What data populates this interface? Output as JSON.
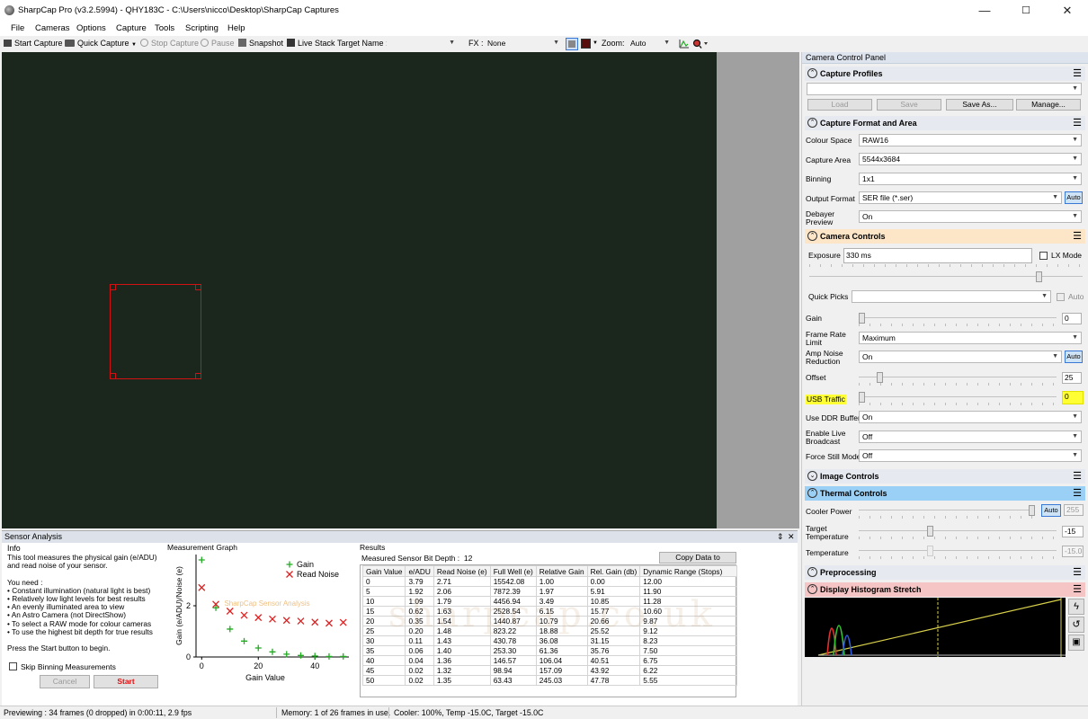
{
  "window": {
    "title": "SharpCap Pro (v3.2.5994) - QHY183C - C:\\Users\\nicco\\Desktop\\SharpCap Captures",
    "controls": {
      "minimize": "—",
      "maximize": "☐",
      "close": "✕"
    }
  },
  "menu": [
    "File",
    "Cameras",
    "Options",
    "Capture",
    "Tools",
    "Scripting",
    "Help"
  ],
  "toolbar": {
    "start_capture": "Start Capture",
    "quick_capture": "Quick Capture",
    "stop_capture": "Stop Capture",
    "pause": "Pause",
    "snapshot": "Snapshot",
    "live_stack": "Live Stack",
    "target_label": "Target Name :",
    "target_value": "",
    "fx_label": "FX :",
    "fx_value": "None",
    "zoom_label": "Zoom:",
    "zoom_value": "Auto"
  },
  "sensor_analysis": {
    "title": "Sensor Analysis",
    "pin": "⇕",
    "close": "✕",
    "info_title": "Info",
    "info_lines": [
      "This tool measures the physical gain (e/ADU)",
      "and read noise of your sensor.",
      "",
      "You need :",
      "• Constant illumination (natural light is best)",
      "• Relatively low light levels for best results",
      "• An evenly illuminated area to view",
      "• An Astro Camera (not DirectShow)",
      "• To select a RAW mode for colour cameras",
      "• To use the highest bit depth for true results",
      "",
      "Press the Start button to begin."
    ],
    "skip_binning": "Skip Binning Measurements",
    "cancel": "Cancel",
    "start": "Start",
    "graph_title": "Measurement Graph",
    "results_title": "Results",
    "bit_depth_label": "Measured Sensor Bit Depth :",
    "bit_depth_value": "12",
    "copy_button": "Copy Data to Clipboard",
    "table_headers": [
      "Gain Value",
      "e/ADU",
      "Read Noise (e)",
      "Full Well (e)",
      "Relative Gain",
      "Rel. Gain (db)",
      "Dynamic Range (Stops)"
    ],
    "table_rows": [
      [
        "0",
        "3.79",
        "2.71",
        "15542.08",
        "1.00",
        "0.00",
        "12.00"
      ],
      [
        "5",
        "1.92",
        "2.06",
        "7872.39",
        "1.97",
        "5.91",
        "11.90"
      ],
      [
        "10",
        "1.09",
        "1.79",
        "4456.94",
        "3.49",
        "10.85",
        "11.28"
      ],
      [
        "15",
        "0.62",
        "1.63",
        "2528.54",
        "6.15",
        "15.77",
        "10.60"
      ],
      [
        "20",
        "0.35",
        "1.54",
        "1440.87",
        "10.79",
        "20.66",
        "9.87"
      ],
      [
        "25",
        "0.20",
        "1.48",
        "823.22",
        "18.88",
        "25.52",
        "9.12"
      ],
      [
        "30",
        "0.11",
        "1.43",
        "430.78",
        "36.08",
        "31.15",
        "8.23"
      ],
      [
        "35",
        "0.06",
        "1.40",
        "253.30",
        "61.36",
        "35.76",
        "7.50"
      ],
      [
        "40",
        "0.04",
        "1.36",
        "146.57",
        "106.04",
        "40.51",
        "6.75"
      ],
      [
        "45",
        "0.02",
        "1.32",
        "98.94",
        "157.09",
        "43.92",
        "6.22"
      ],
      [
        "50",
        "0.02",
        "1.35",
        "63.43",
        "245.03",
        "47.78",
        "5.55"
      ]
    ],
    "graph_watermark": "SharpCap Sensor Analysis",
    "watermark": "sharpcap.co.uk"
  },
  "chart_data": {
    "type": "scatter",
    "xlabel": "Gain Value",
    "ylabel": "Gain (e/ADU)/Noise (e)",
    "xlim": [
      -2,
      52
    ],
    "ylim": [
      0,
      4
    ],
    "xticks": [
      "0",
      "20",
      "40"
    ],
    "yticks": [
      "0",
      "2"
    ],
    "series": [
      {
        "name": "Gain",
        "marker": "+",
        "color": "#22aa22",
        "x": [
          0,
          5,
          10,
          15,
          20,
          25,
          30,
          35,
          40,
          45,
          50
        ],
        "y": [
          3.79,
          1.92,
          1.09,
          0.62,
          0.35,
          0.2,
          0.11,
          0.06,
          0.04,
          0.02,
          0.02
        ]
      },
      {
        "name": "Read Noise",
        "marker": "x",
        "color": "#dd2222",
        "x": [
          0,
          5,
          10,
          15,
          20,
          25,
          30,
          35,
          40,
          45,
          50
        ],
        "y": [
          2.71,
          2.06,
          1.79,
          1.63,
          1.54,
          1.48,
          1.43,
          1.4,
          1.36,
          1.32,
          1.35
        ]
      }
    ],
    "legend": "top-right"
  },
  "status": {
    "preview": "Previewing : 34 frames (0 dropped) in 0:00:11, 2.9 fps",
    "memory": "Memory: 1 of 26 frames in use.",
    "cooler": "Cooler: 100%, Temp -15.0C, Target -15.0C"
  },
  "panel": {
    "title": "Camera Control Panel",
    "capture_profiles": {
      "title": "Capture Profiles",
      "load": "Load",
      "save": "Save",
      "save_as": "Save As...",
      "manage": "Manage...",
      "profile_value": ""
    },
    "capture_format": {
      "title": "Capture Format and Area",
      "colour_space_label": "Colour Space",
      "colour_space": "RAW16",
      "capture_area_label": "Capture Area",
      "capture_area": "5544x3684",
      "binning_label": "Binning",
      "binning": "1x1",
      "output_format_label": "Output Format",
      "output_format": "SER file (*.ser)",
      "auto": "Auto",
      "debayer_label_1": "Debayer",
      "debayer_label_2": "Preview",
      "debayer": "On"
    },
    "camera_controls": {
      "title": "Camera Controls",
      "exposure_label": "Exposure",
      "exposure": "330 ms",
      "lx_mode": "LX Mode",
      "quick_picks_label": "Quick Picks",
      "quick_picks_auto": "Auto",
      "gain_label": "Gain",
      "gain": "0",
      "frame_rate_label_1": "Frame Rate",
      "frame_rate_label_2": "Limit",
      "frame_rate": "Maximum",
      "amp_noise_label_1": "Amp Noise",
      "amp_noise_label_2": "Reduction",
      "amp_noise": "On",
      "amp_auto": "Auto",
      "offset_label": "Offset",
      "offset": "25",
      "usb_label": "USB Traffic",
      "usb": "0",
      "ddr_label": "Use DDR Buffer",
      "ddr": "On",
      "broadcast_label_1": "Enable Live",
      "broadcast_label_2": "Broadcast",
      "broadcast": "Off",
      "force_still_label": "Force Still Mode",
      "force_still": "Off"
    },
    "image_controls": {
      "title": "Image Controls"
    },
    "thermal_controls": {
      "title": "Thermal Controls",
      "cooler_power_label": "Cooler Power",
      "cooler_auto": "Auto",
      "cooler_power": "255",
      "target_temp_label_1": "Target",
      "target_temp_label_2": "Temperature",
      "target_temp": "-15",
      "temperature_label": "Temperature",
      "temperature": "-15.0"
    },
    "preprocessing": {
      "title": "Preprocessing"
    },
    "histogram": {
      "title": "Display Histogram Stretch"
    }
  },
  "colors": {
    "preview_bg": "#1b261c",
    "highlight": "#ffff33",
    "camera_controls_header": "#fde5c8",
    "thermal_header": "#9ad0f5",
    "histogram_header": "#f5c4c4"
  }
}
